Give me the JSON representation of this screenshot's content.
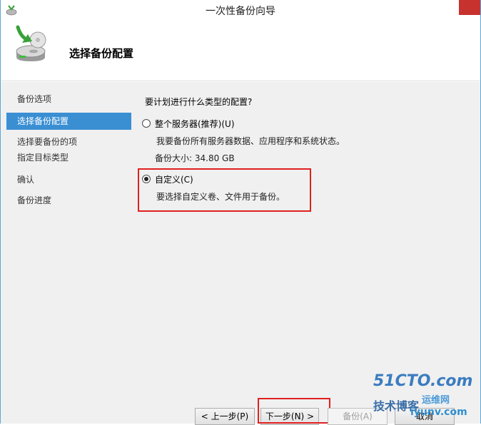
{
  "window": {
    "title": "一次性备份向导"
  },
  "header": {
    "title": "选择备份配置"
  },
  "nav": {
    "items": [
      {
        "label": "备份选项",
        "active": false
      },
      {
        "label": "选择备份配置",
        "active": true
      },
      {
        "label": "选择要备份的项",
        "active": false
      },
      {
        "label": "指定目标类型",
        "active": false
      },
      {
        "label": "确认",
        "active": false
      },
      {
        "label": "备份进度",
        "active": false
      }
    ]
  },
  "content": {
    "question": "要计划进行什么类型的配置?",
    "options": [
      {
        "label": "整个服务器(推荐)(U)",
        "description": "我要备份所有服务器数据、应用程序和系统状态。",
        "size_text": "备份大小: 34.80 GB",
        "selected": false
      },
      {
        "label": "自定义(C)",
        "description": "要选择自定义卷、文件用于备份。",
        "selected": true
      }
    ]
  },
  "buttons": {
    "prev": "< 上一步(P)",
    "next": "下一步(N) >",
    "backup": "备份(A)",
    "cancel": "取消"
  },
  "watermark": {
    "site": "51CTO.com",
    "line1": "技术博客",
    "line2": "运维网",
    "url": "iyunv.com"
  },
  "colors": {
    "accent": "#3a8fd3",
    "highlight": "#e02020",
    "close": "#c7312e"
  }
}
